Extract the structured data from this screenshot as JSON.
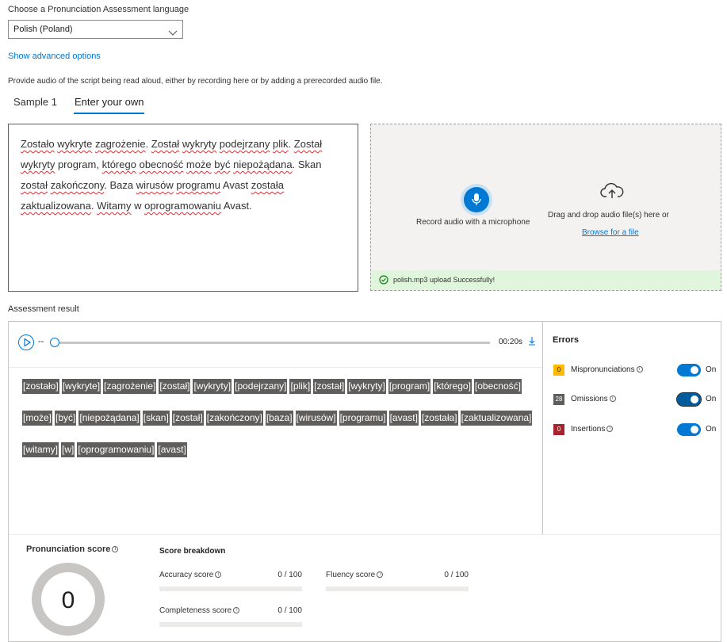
{
  "language": {
    "label": "Choose a Pronunciation Assessment language",
    "selected": "Polish (Poland)"
  },
  "advanced_link": "Show advanced options",
  "provide_text": "Provide audio of the script being read aloud, either by recording here or by adding a prerecorded audio file.",
  "tabs": [
    {
      "label": "Sample 1",
      "active": false
    },
    {
      "label": "Enter your own",
      "active": true
    }
  ],
  "script_text": [
    {
      "t": "Zostało",
      "u": true
    },
    {
      "t": " "
    },
    {
      "t": "wykryte",
      "u": true
    },
    {
      "t": " "
    },
    {
      "t": "zagrożenie",
      "u": true
    },
    {
      "t": ". "
    },
    {
      "t": "Został",
      "u": true
    },
    {
      "t": " "
    },
    {
      "t": "wykryty",
      "u": true
    },
    {
      "t": " "
    },
    {
      "t": "podejrzany",
      "u": true
    },
    {
      "t": " "
    },
    {
      "t": "plik",
      "u": true
    },
    {
      "t": ". "
    },
    {
      "t": "Został",
      "u": true
    },
    {
      "t": " "
    },
    {
      "t": "wykryty",
      "u": true
    },
    {
      "t": " program, "
    },
    {
      "t": "którego",
      "u": true
    },
    {
      "t": " "
    },
    {
      "t": "obecność",
      "u": true
    },
    {
      "t": " "
    },
    {
      "t": "może",
      "u": true
    },
    {
      "t": " "
    },
    {
      "t": "być",
      "u": true
    },
    {
      "t": " "
    },
    {
      "t": "niepożądana",
      "u": true
    },
    {
      "t": ". Skan "
    },
    {
      "t": "został",
      "u": true
    },
    {
      "t": " "
    },
    {
      "t": "zakończony",
      "u": true
    },
    {
      "t": ". Baza "
    },
    {
      "t": "wirusów",
      "u": true
    },
    {
      "t": " "
    },
    {
      "t": "programu",
      "u": true
    },
    {
      "t": " Avast "
    },
    {
      "t": "została",
      "u": true
    },
    {
      "t": " "
    },
    {
      "t": "zaktualizowana",
      "u": true
    },
    {
      "t": ". "
    },
    {
      "t": "Witamy",
      "u": true
    },
    {
      "t": " w "
    },
    {
      "t": "oprogramowaniu",
      "u": true
    },
    {
      "t": " Avast."
    }
  ],
  "record": {
    "label": "Record audio with a microphone"
  },
  "upload": {
    "drag_label": "Drag and drop audio file(s) here or",
    "browse_label": "Browse for a file",
    "status": "polish.mp3 upload Successfully!"
  },
  "assessment": {
    "label": "Assessment result",
    "player": {
      "position": "--",
      "duration": "00:20s"
    },
    "words": [
      "[zostało]",
      "[wykryte]",
      "[zagrożenie]",
      "[został]",
      "[wykryty]",
      "[podejrzany]",
      "[plik]",
      "[został]",
      "[wykryty]",
      "[program]",
      "[którego]",
      "[obecność]",
      "[może]",
      "[być]",
      "[niepożądana]",
      "[skan]",
      "[został]",
      "[zakończony]",
      "[baza]",
      "[wirusów]",
      "[programu]",
      "[avast]",
      "[została]",
      "[zaktualizowana]",
      "[witamy]",
      "[w]",
      "[oprogramowaniu]",
      "[avast]"
    ]
  },
  "errors": {
    "title": "Errors",
    "items": [
      {
        "name": "Mispronunciations",
        "count": "0",
        "color": "#ffb900",
        "text_color": "#201f1e",
        "toggle": "On"
      },
      {
        "name": "Omissions",
        "count": "28",
        "color": "#605e5c",
        "text_color": "#ffffff",
        "toggle": "On"
      },
      {
        "name": "Insertions",
        "count": "0",
        "color": "#a4262c",
        "text_color": "#ffffff",
        "toggle": "On"
      }
    ]
  },
  "scores": {
    "pronunciation_label": "Pronunciation score",
    "pronunciation_value": "0",
    "breakdown_label": "Score breakdown",
    "accuracy": {
      "label": "Accuracy score",
      "value": "0 / 100",
      "fill": 0
    },
    "fluency": {
      "label": "Fluency score",
      "value": "0 / 100",
      "fill": 0
    },
    "completeness": {
      "label": "Completeness score",
      "value": "0 / 100",
      "fill": 0
    }
  },
  "colors": {
    "accent": "#0078d4",
    "success_bg": "#dff6dd",
    "word_bg": "#605e5c"
  }
}
